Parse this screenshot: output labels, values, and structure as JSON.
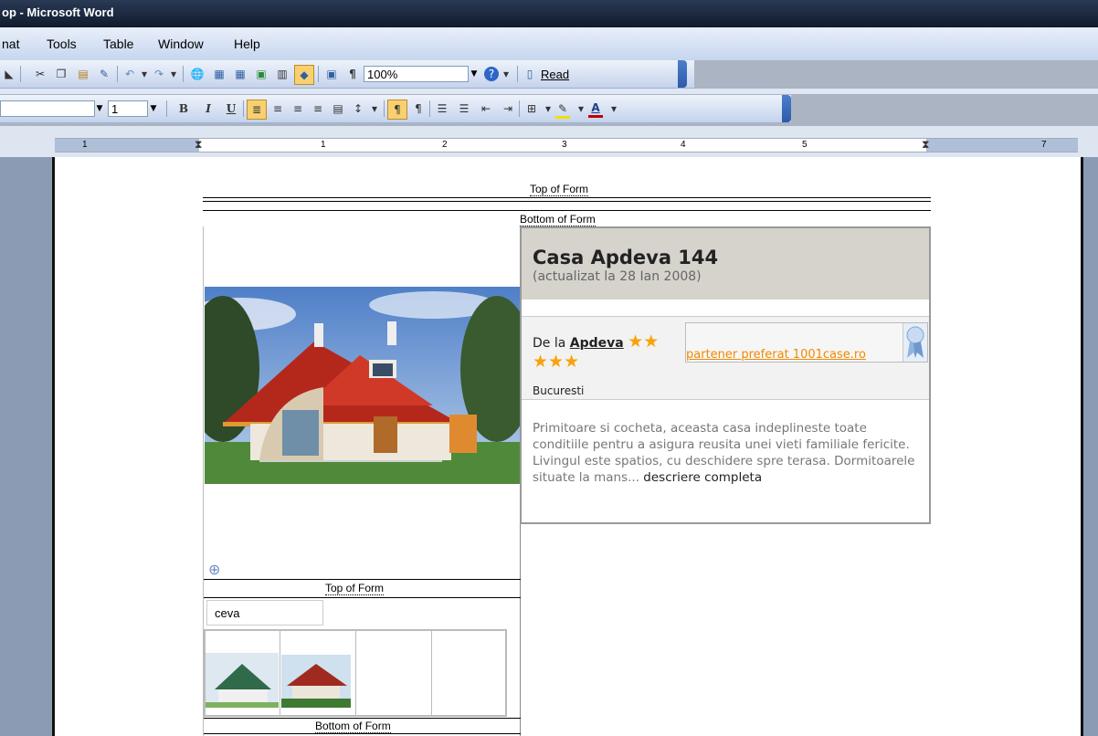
{
  "window": {
    "title": "op - Microsoft Word"
  },
  "menu": [
    "nat",
    "Tools",
    "Table",
    "Window",
    "Help"
  ],
  "toolbar": {
    "zoom": "100%",
    "read_label": "Read"
  },
  "formatting": {
    "font_size": "1"
  },
  "ruler": {
    "labels": [
      "1",
      "1",
      "2",
      "3",
      "4",
      "5",
      "7"
    ]
  },
  "document": {
    "top_of_form": "Top of Form",
    "bottom_of_form": "Bottom of Form",
    "title": "Casa Apdeva 144",
    "updated": "(actualizat la 28 Ian 2008)",
    "from_prefix": "De la",
    "from_name": "Apdeva",
    "stars_first": "★★",
    "stars_second": "★★★",
    "partner_link": "partener preferat 1001case.ro",
    "city": "Bucuresti",
    "description": "Primitoare si cocheta, aceasta casa indeplineste toate conditiile pentru a asigura reusita unei vieti familiale fericite. Livingul este spatios, cu deschidere spre terasa. Dormitoarele situate la mans...",
    "description_more": "descriere completa",
    "search_value": "ceva"
  },
  "colors": {
    "accent": "#f08a00",
    "stars": "#f7a30a",
    "header_bg": "#d6d3cd",
    "titlebar": "#1c2a42"
  }
}
